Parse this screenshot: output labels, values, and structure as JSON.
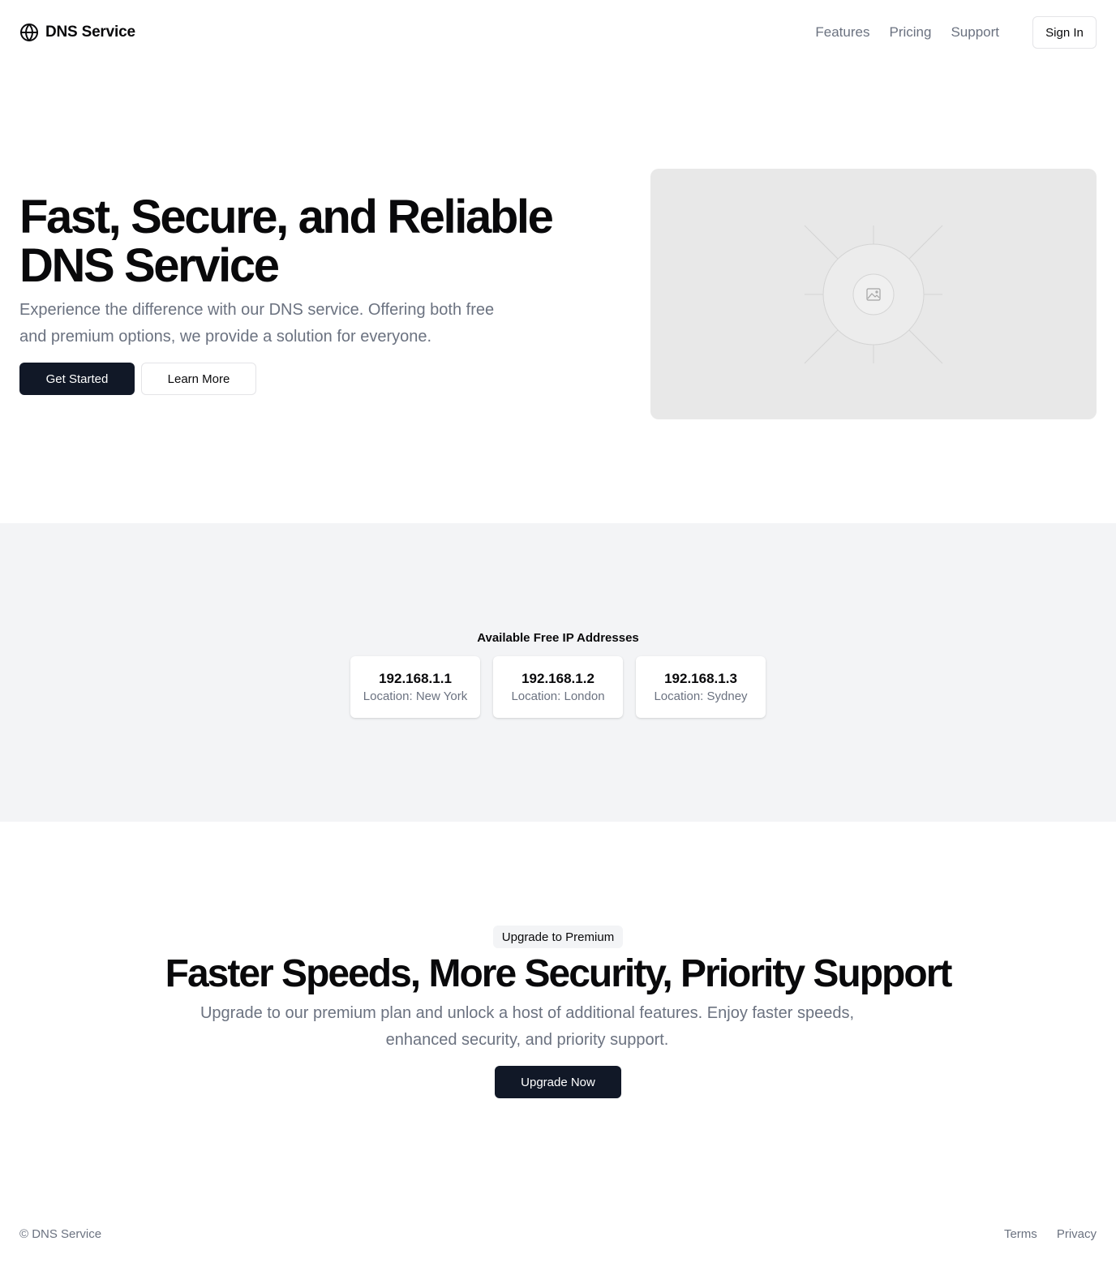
{
  "header": {
    "brand": "DNS Service",
    "brand_icon": "globe-icon",
    "nav": [
      "Features",
      "Pricing",
      "Support"
    ],
    "signin_label": "Sign In"
  },
  "hero": {
    "title": "Fast, Secure, and Reliable DNS Service",
    "subtitle": "Experience the difference with our DNS service. Offering both free and premium options, we provide a solution for everyone.",
    "primary_label": "Get Started",
    "secondary_label": "Learn More",
    "image_icon": "image-placeholder-icon"
  },
  "ip_section": {
    "heading": "Available Free IP Addresses",
    "cards": [
      {
        "ip": "192.168.1.1",
        "location": "Location: New York"
      },
      {
        "ip": "192.168.1.2",
        "location": "Location: London"
      },
      {
        "ip": "192.168.1.3",
        "location": "Location: Sydney"
      }
    ]
  },
  "premium": {
    "badge": "Upgrade to Premium",
    "title": "Faster Speeds, More Security, Priority Support",
    "subtitle": "Upgrade to our premium plan and unlock a host of additional features. Enjoy faster speeds, enhanced security, and priority support.",
    "cta_label": "Upgrade Now"
  },
  "footer": {
    "copyright": "© DNS Service",
    "links": [
      "Terms",
      "Privacy"
    ]
  },
  "colors": {
    "primary": "#111827",
    "muted_text": "#6b7280",
    "section_bg": "#f3f4f6",
    "placeholder_bg": "#e8e8e8"
  }
}
